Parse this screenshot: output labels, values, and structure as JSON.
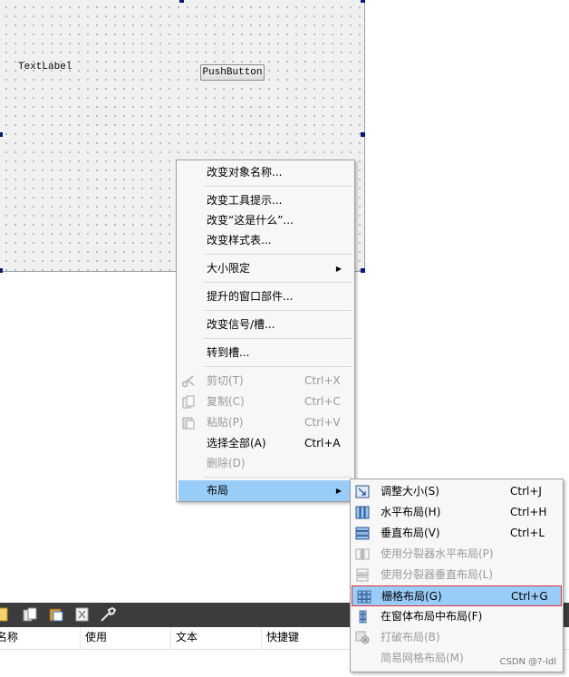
{
  "form": {
    "text_label": "TextLabel",
    "push_button": "PushButton"
  },
  "context_menu": {
    "rename": "改变对象名称...",
    "tooltip": "改变工具提示...",
    "whats_this": "改变“这是什么”...",
    "stylesheet": "改变样式表...",
    "size_constraints": "大小限定",
    "promote": "提升的窗口部件...",
    "signals_slots": "改变信号/槽...",
    "go_to_slot": "转到槽...",
    "cut": "剪切(T)",
    "cut_shortcut": "Ctrl+X",
    "copy": "复制(C)",
    "copy_shortcut": "Ctrl+C",
    "paste": "粘贴(P)",
    "paste_shortcut": "Ctrl+V",
    "select_all": "选择全部(A)",
    "select_all_shortcut": "Ctrl+A",
    "delete": "删除(D)",
    "layout": "布局"
  },
  "layout_menu": {
    "adjust_size": "调整大小(S)",
    "adjust_size_shortcut": "Ctrl+J",
    "horizontal": "水平布局(H)",
    "horizontal_shortcut": "Ctrl+H",
    "vertical": "垂直布局(V)",
    "vertical_shortcut": "Ctrl+L",
    "splitter_h": "使用分裂器水平布局(P)",
    "splitter_v": "使用分裂器垂直布局(L)",
    "grid": "栅格布局(G)",
    "grid_shortcut": "Ctrl+G",
    "form_layout": "在窗体布局中布局(F)",
    "break_layout": "打破布局(B)",
    "simplify_grid": "简易网格布局(M)"
  },
  "action_editor": {
    "columns": [
      "名称",
      "使用",
      "文本",
      "快捷键"
    ]
  },
  "watermark": "CSDN @?-ldl",
  "colors": {
    "highlight": "#99ccf7",
    "highlight_border": "#e0303a",
    "toolbar": "#3c3c3c"
  }
}
